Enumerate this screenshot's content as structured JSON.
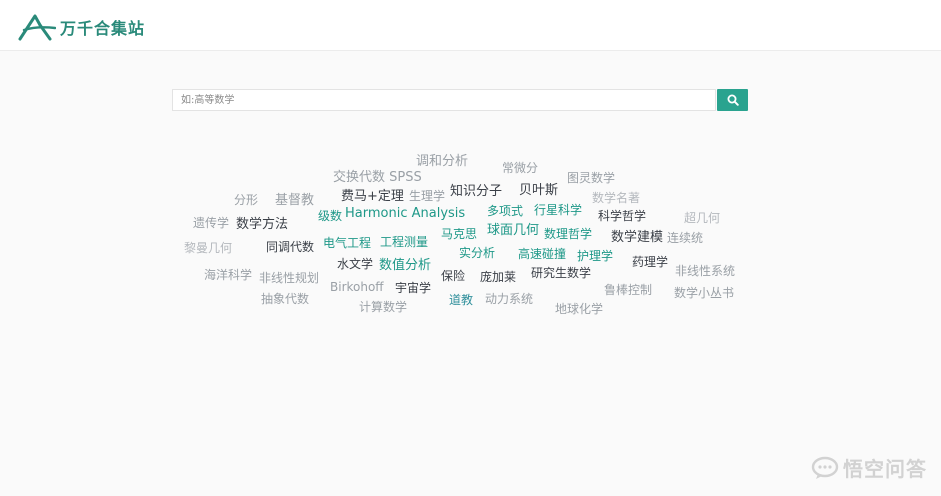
{
  "header": {
    "logo_text": "万千合集站"
  },
  "search": {
    "placeholder": "如:高等数学",
    "button_icon": "search-icon"
  },
  "tags": [
    "调和分析",
    "常微分",
    "交换代数 SPSS",
    "图灵数学",
    "分形",
    "基督教",
    "费马+定理",
    "生理学",
    "知识分子",
    "贝叶斯",
    "数学名著",
    "级数",
    "Harmonic Analysis",
    "多项式",
    "行星科学",
    "科学哲学",
    "超几何",
    "遗传学",
    "数学方法",
    "马克思",
    "球面几何",
    "数理哲学",
    "数学建模",
    "连续统",
    "黎曼几何",
    "同调代数",
    "电气工程",
    "工程测量",
    "实分析",
    "高速碰撞",
    "护理学",
    "药理学",
    "海洋科学",
    "非线性规划",
    "水文学",
    "数值分析",
    "保险",
    "庞加莱",
    "研究生数学",
    "非线性系统",
    "Birkohoff",
    "宇宙学",
    "鲁棒控制",
    "数学小丛书",
    "抽象代数",
    "道教",
    "动力系统",
    "计算数学",
    "地球化学"
  ],
  "watermark": {
    "text": "悟空问答"
  }
}
